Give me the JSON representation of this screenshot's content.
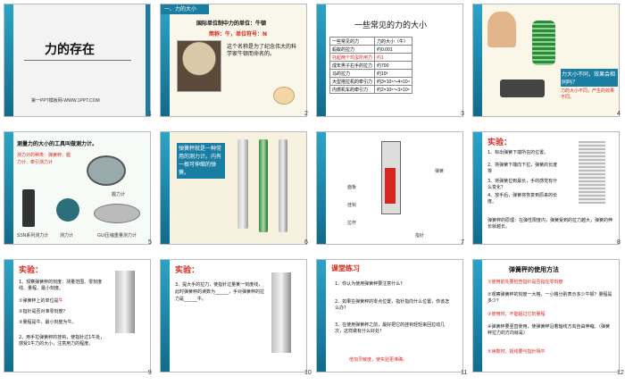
{
  "slides": [
    {
      "num": "1",
      "title": "力的存在",
      "footer": "第一PPT模板网-WWW.1PPT.COM"
    },
    {
      "num": "2",
      "section": "一、力的大小",
      "heading": "国际单位制中力的单位：牛顿",
      "abbr": "简称：牛，单位符号：N",
      "body": "这个名称是为了纪念伟大的科学家牛顿而命名的。"
    },
    {
      "num": "3",
      "title": "一些常见的力的大小",
      "table": [
        [
          "一些常见的力",
          "力的大小（牛）"
        ],
        [
          "蚂蚁的拉力",
          "约0.001"
        ],
        [
          "托起两个鸡蛋所用力",
          "约1"
        ],
        [
          "成年男子右手的拉力",
          "约700"
        ],
        [
          "马的拉力",
          "约10³"
        ],
        [
          "大型拖拉机的牵引力",
          "约3×10⁴～4×10⁴"
        ],
        [
          "内燃机车的牵引力",
          "约2×10⁵～3×10⁵"
        ]
      ]
    },
    {
      "num": "4",
      "caption": "力大小不同，效果会相同吗？",
      "body": "力的大小不同，产生的效果不同。"
    },
    {
      "num": "5",
      "title": "测量力的大小的工具叫做测力计。",
      "subtitle": "测力计的种类：弹簧秤、握力计、牵引测力计",
      "labels": [
        "握力计",
        "SSN系列测力计",
        "测力计",
        "GUI压缩重量测力计"
      ]
    },
    {
      "num": "6",
      "body": "弹簧秤就是一种常用的测力计。内有一根可伸缩的弹簧。"
    },
    {
      "num": "7",
      "labels": [
        "弹簧",
        "面板",
        "挂钩",
        "拉杆",
        "指针"
      ]
    },
    {
      "num": "8",
      "title": "实验：",
      "items": [
        "1、标出弹簧下端所在的位置。",
        "2、将弹簧下端向下拉，弹簧的长度将",
        "3、将弹簧拉到最长，手的感觉有什么变化？",
        "4、放手后，弹簧将恢复到原来的长度。"
      ],
      "note": "弹簧秤的原理：在弹性限度内，弹簧受到的拉力越大，弹簧的伸长就越长。"
    },
    {
      "num": "9",
      "title": "实验：",
      "items": [
        "1、观察弹簧秤的刻度：测量范围、零刻度线、量程、最小刻度。",
        "①弹簧秤上的单位是",
        "牛",
        "②指针是否对准零刻度？",
        "③量程是",
        "牛，最小刻度为",
        "牛。",
        "2、用手拉弹簧秤的挂钩，使指针过1牛处，感受1牛力的大小，注意用力的程度。"
      ]
    },
    {
      "num": "10",
      "title": "实验：",
      "body": "3、提大手的拉力，使指针过量某一刻度线，此时弹簧秤的读数为______，手对弹簧秤的拉力是______牛。"
    },
    {
      "num": "11",
      "title": "课堂练习",
      "items": [
        "1、你认为使用弹簧秤要注意什么？",
        "2、如果在弹簧秤的零点位置，指针指向什么位置，你该怎么办？",
        "3、在使用弹簧秤之前，最好把它的挂钩轻轻来回拉动几次，这样做有什么好处？"
      ],
      "footer": "增加灵敏度，使实验更准确。"
    },
    {
      "num": "12",
      "title": "弹簧秤的使用方法",
      "items": [
        "①使用前先要检查指针是否指在零刻度",
        "②观察弹簧秤的刻度一大格、一小格分别表示多少牛顿？量程是多少？",
        "③使用时，不能超过它的量程",
        "④弹簧秤要竖直使用，使弹簧秤沿着轴线方向自由伸缩。（弹簧秤拉力的方向就是）",
        "⑤读数时，视线要与指针相平"
      ]
    }
  ],
  "colors": {
    "accent_blue": "#1a7ea3",
    "accent_red": "#d7261e",
    "title_bg": "#f2f2f2"
  }
}
